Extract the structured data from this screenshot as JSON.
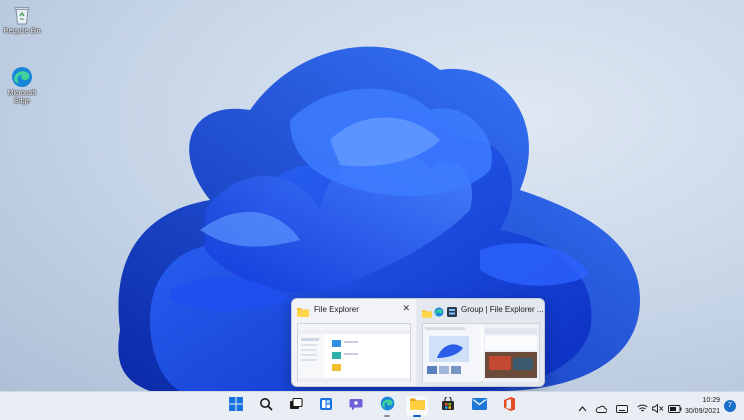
{
  "desktop": {
    "icons": [
      {
        "label": "Recycle Bin",
        "icon": "recycle-bin-icon"
      },
      {
        "label": "Microsoft Edge",
        "icon": "edge-icon"
      }
    ]
  },
  "preview": {
    "cards": [
      {
        "title": "File Explorer",
        "icon": "folder-icon",
        "close": "✕"
      },
      {
        "title": "Group | File Explorer ...",
        "icons": [
          "folder-icon",
          "edge-icon",
          "group-icon"
        ]
      }
    ]
  },
  "taskbar": {
    "apps": [
      {
        "name": "start",
        "icon": "windows-logo-icon"
      },
      {
        "name": "search",
        "icon": "search-icon"
      },
      {
        "name": "task-view",
        "icon": "task-view-icon"
      },
      {
        "name": "widgets",
        "icon": "widgets-icon"
      },
      {
        "name": "teams-chat",
        "icon": "chat-icon"
      },
      {
        "name": "edge",
        "icon": "edge-icon"
      },
      {
        "name": "file-explorer",
        "icon": "folder-icon"
      },
      {
        "name": "store",
        "icon": "store-icon"
      },
      {
        "name": "mail",
        "icon": "mail-icon"
      },
      {
        "name": "office",
        "icon": "office-icon"
      }
    ],
    "tray": {
      "chevron": "^",
      "time": "10:29",
      "date": "30/09/2021",
      "notifications": "7"
    }
  },
  "colors": {
    "accent": "#0a64c8",
    "wallpaper_blue": "#1f4fe0"
  }
}
